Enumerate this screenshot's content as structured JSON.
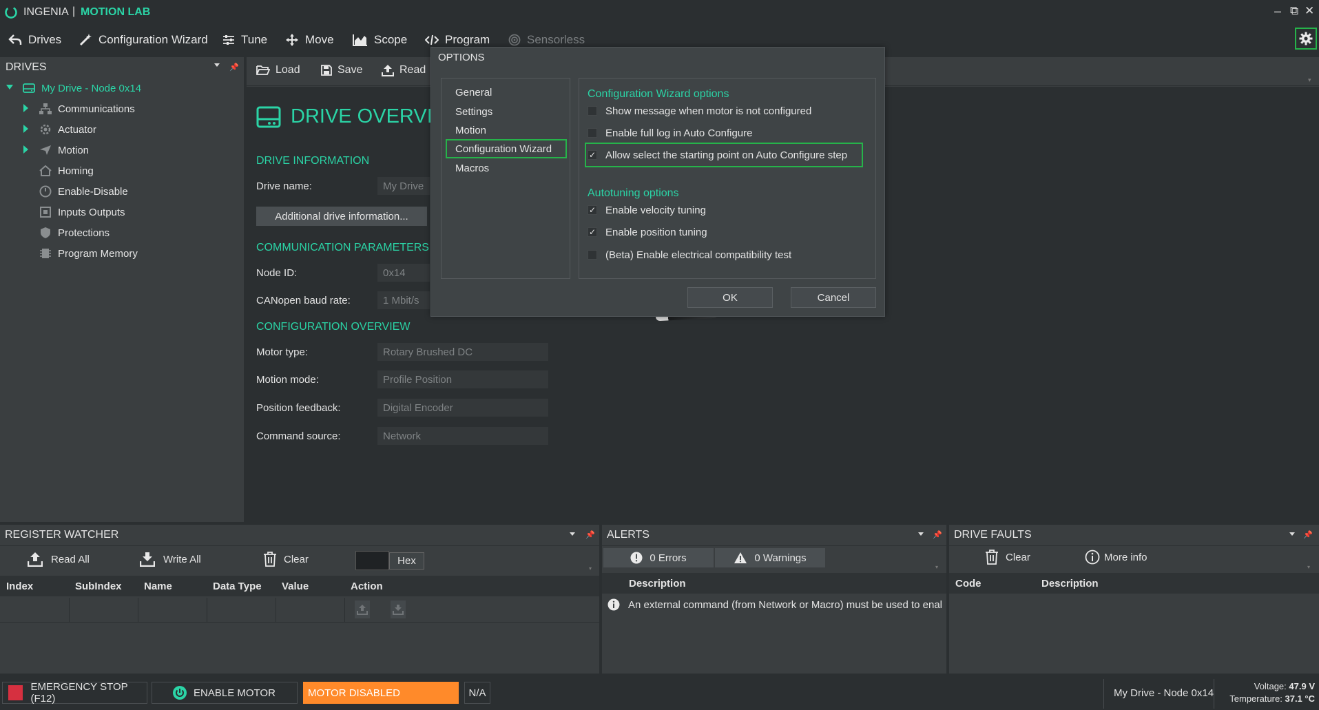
{
  "app": {
    "brand": "INGENIA",
    "separator": "|",
    "product": "MOTION LAB"
  },
  "window_controls": {
    "minimize": "–",
    "restore": "⧉",
    "close": "✕"
  },
  "toolbar": {
    "drives": "Drives",
    "config_wizard": "Configuration Wizard",
    "tune": "Tune",
    "move": "Move",
    "scope": "Scope",
    "program": "Program",
    "sensorless": "Sensorless"
  },
  "drives_panel": {
    "title": "DRIVES",
    "root": "My Drive - Node 0x14",
    "items": [
      "Communications",
      "Actuator",
      "Motion",
      "Homing",
      "Enable-Disable",
      "Inputs Outputs",
      "Protections",
      "Program Memory"
    ]
  },
  "overview_toolbar": {
    "load": "Load",
    "save": "Save",
    "read": "Read"
  },
  "overview": {
    "title": "DRIVE OVERVIE",
    "drive_info_header": "DRIVE INFORMATION",
    "drive_name_label": "Drive name:",
    "drive_name_value": "My Drive",
    "additional_button": "Additional drive information...",
    "comm_header": "COMMUNICATION PARAMETERS",
    "node_id_label": "Node ID:",
    "node_id_value": "0x14",
    "baud_label": "CANopen baud rate:",
    "baud_value": "1 Mbit/s",
    "config_header": "CONFIGURATION OVERVIEW",
    "motor_type_label": "Motor type:",
    "motor_type_value": "Rotary Brushed DC",
    "motion_mode_label": "Motion mode:",
    "motion_mode_value": "Profile Position",
    "position_feedback_label": "Position feedback:",
    "position_feedback_value": "Digital Encoder",
    "command_source_label": "Command source:",
    "command_source_value": "Network"
  },
  "options_dialog": {
    "title": "OPTIONS",
    "nav": [
      "General",
      "Settings",
      "Motion",
      "Configuration Wizard",
      "Macros"
    ],
    "selected_nav": "Configuration Wizard",
    "wizard_header": "Configuration Wizard options",
    "wizard_options": [
      {
        "label": "Show message when motor is not configured",
        "checked": false
      },
      {
        "label": "Enable full log in Auto Configure",
        "checked": false
      },
      {
        "label": "Allow select the starting point on Auto Configure step",
        "checked": true
      }
    ],
    "autotune_header": "Autotuning options",
    "autotune_options": [
      {
        "label": "Enable velocity tuning",
        "checked": true
      },
      {
        "label": "Enable position tuning",
        "checked": true
      },
      {
        "label": "(Beta) Enable electrical compatibility test",
        "checked": false
      }
    ],
    "ok": "OK",
    "cancel": "Cancel",
    "check_mark": "✓"
  },
  "register_watcher": {
    "title": "REGISTER WATCHER",
    "read_all": "Read All",
    "write_all": "Write All",
    "clear": "Clear",
    "hex": "Hex",
    "columns": [
      "Index",
      "SubIndex",
      "Name",
      "Data Type",
      "Value",
      "Action"
    ]
  },
  "alerts": {
    "title": "ALERTS",
    "errors": "0 Errors",
    "warnings": "0 Warnings",
    "column": "Description",
    "message": "An external command (from Network or Macro) must be used to enal"
  },
  "drive_faults": {
    "title": "DRIVE FAULTS",
    "clear": "Clear",
    "more_info": "More info",
    "columns": [
      "Code",
      "Description"
    ]
  },
  "status_bar": {
    "emergency": "EMERGENCY STOP (F12)",
    "enable_motor": "ENABLE MOTOR",
    "motor_state": "MOTOR DISABLED",
    "na": "N/A",
    "drive": "My Drive - Node 0x14",
    "voltage_label": "Voltage:",
    "voltage_value": "47.9 V",
    "temperature_label": "Temperature:",
    "temperature_value": "37.1 °C"
  },
  "colors": {
    "accent": "#2bd4a6",
    "highlight": "#26b34a",
    "motor_disabled": "#ff8a2a",
    "emergency": "#d63040"
  },
  "icons": [
    "ingenia-logo-icon",
    "back-arrow-icon",
    "wand-icon",
    "sliders-icon",
    "move-arrows-icon",
    "chart-icon",
    "code-icon",
    "sensorless-icon",
    "gear-icon",
    "folder-icon",
    "save-icon",
    "upload-icon",
    "drive-icon",
    "info-icon",
    "warning-icon",
    "trash-icon",
    "download-icon",
    "power-icon",
    "pin-icon",
    "dropdown-icon"
  ]
}
